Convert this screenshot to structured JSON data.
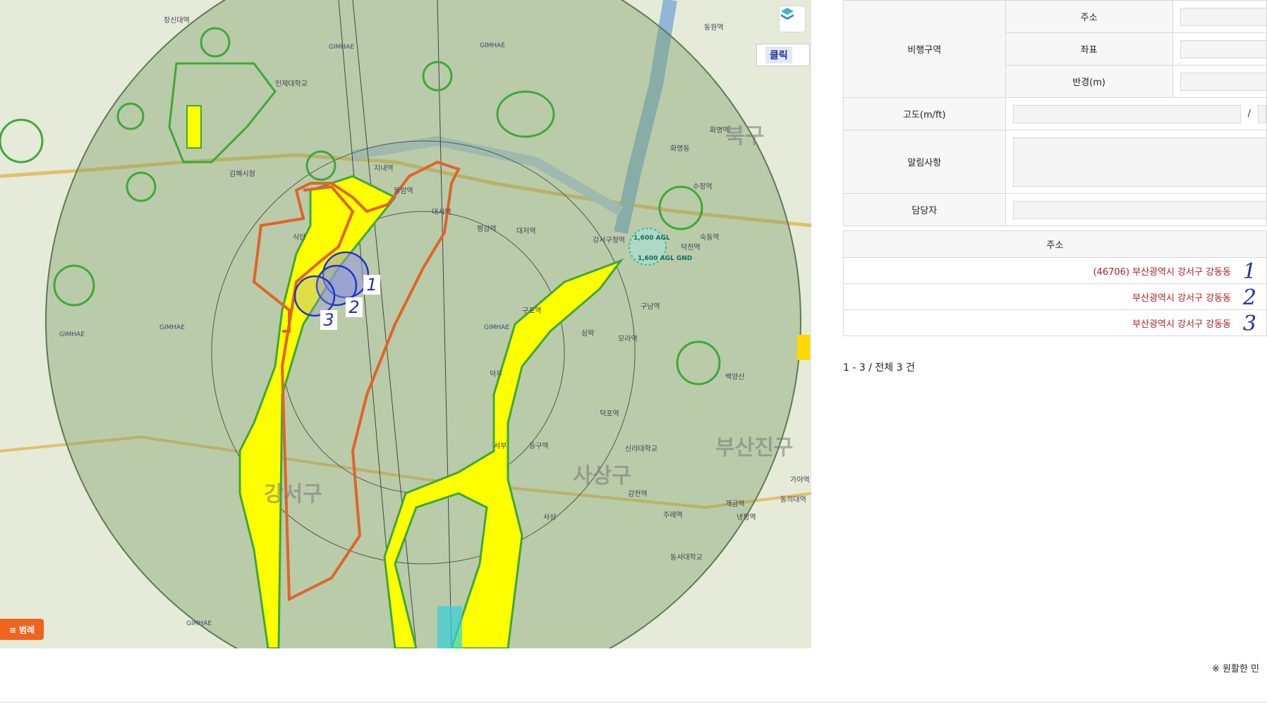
{
  "map": {
    "layer_icon": "layers-icon",
    "click_button_label": "클릭",
    "legend_button_label": "≡ 범례",
    "district_labels": [
      "북구",
      "부산진구",
      "강서구",
      "사상구"
    ],
    "place_labels": [
      "장신대역",
      "인제대학교",
      "김해시청",
      "지내역",
      "불암역",
      "대사역",
      "식만",
      "평강역",
      "대저역",
      "강서구청역",
      "덕천역",
      "구남역",
      "모라역",
      "덕두",
      "서부",
      "감전역",
      "사상",
      "가야역",
      "동의대역",
      "신라대학교",
      "동서대학교",
      "화명역",
      "화명동",
      "수정역",
      "동원역",
      "구포역",
      "숙동역",
      "냉정역",
      "개금역",
      "주례역",
      "덕포역",
      "백양산",
      "등구역",
      "삼락"
    ],
    "airspace_labels": [
      "1,600 AGL",
      "1,600 AGL GND"
    ],
    "gimhae_label": "GIMHAE",
    "point_markers": [
      "1",
      "2",
      "3"
    ]
  },
  "form": {
    "flight_zone_label": "비행구역",
    "address_label": "주소",
    "coord_label": "좌표",
    "radius_label": "반경(m)",
    "altitude_label": "고도(m/ft)",
    "altitude_separator": "/",
    "notice_label": "알림사항",
    "manager_label": "담당자"
  },
  "address_list": {
    "header": "주소",
    "rows": [
      {
        "address": "(46706) 부산광역시 강서구 강동동",
        "index": "1"
      },
      {
        "address": "부산광역시 강서구 강동동",
        "index": "2"
      },
      {
        "address": "부산광역시 강서구 강동동",
        "index": "3"
      }
    ],
    "count_text": "1 - 3 / 전체 3 건"
  },
  "footer": {
    "notice_text": "※ 원활한 민"
  },
  "colors": {
    "zone_green": "#3ea83a",
    "zone_yellow": "#ffff00",
    "boundary_orange": "#e0642a",
    "circle_blue": "#2233cc",
    "airspace_fill": "#7fa06a",
    "legend_orange": "#f1641e"
  }
}
